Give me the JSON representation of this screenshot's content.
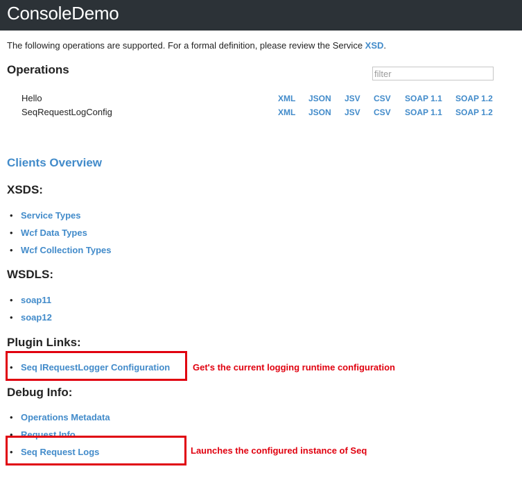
{
  "header": {
    "title": "ConsoleDemo"
  },
  "intro": {
    "text": "The following operations are supported. For a formal definition, please review the Service ",
    "xsd_link": "XSD",
    "end": "."
  },
  "operations": {
    "heading": "Operations",
    "filter_placeholder": "filter",
    "formats": [
      "XML",
      "JSON",
      "JSV",
      "CSV",
      "SOAP 1.1",
      "SOAP 1.2"
    ],
    "items": [
      "Hello",
      "SeqRequestLogConfig"
    ]
  },
  "clients_overview": "Clients Overview",
  "xsds": {
    "heading": "XSDS:",
    "links": [
      "Service Types",
      "Wcf Data Types",
      "Wcf Collection Types"
    ]
  },
  "wsdls": {
    "heading": "WSDLS:",
    "links": [
      "soap11",
      "soap12"
    ]
  },
  "plugin_links": {
    "heading": "Plugin Links:",
    "links": [
      "Seq IRequestLogger Configuration"
    ]
  },
  "debug_info": {
    "heading": "Debug Info:",
    "links": [
      "Operations Metadata",
      "Request Info",
      "Seq Request Logs"
    ]
  },
  "annotations": {
    "plugin_note": "Get's the current logging runtime configuration",
    "debug_note": "Launches the configured instance of Seq",
    "color": "#e0000f"
  },
  "colors": {
    "header_bg": "#2c3237",
    "link": "#428bca"
  }
}
